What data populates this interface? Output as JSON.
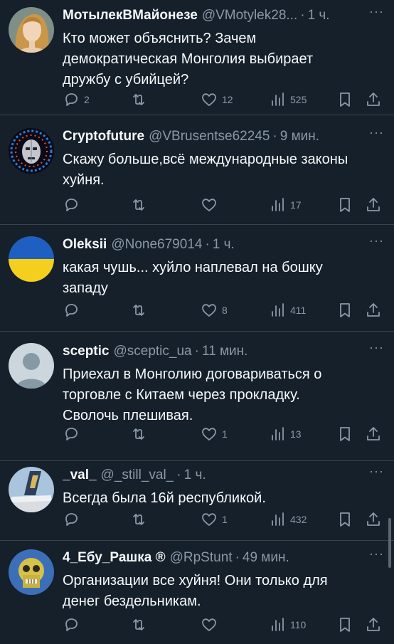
{
  "tweets": [
    {
      "name": "МотылекВМайонезе",
      "handle": "@VMotylek28...",
      "time": "1 ч.",
      "text": "Кто может объяснить? Зачем\nдемократическая Монголия выбирает\nдружбу с убийцей?",
      "replies": "2",
      "retweets": "",
      "likes": "12",
      "views": "525",
      "avatar": "venus-painting"
    },
    {
      "name": "Cryptofuture",
      "handle": "@VBrusentse62245",
      "time": "9 мин.",
      "text": "Скажу больше,всё международные законы\nхуйня.",
      "replies": "",
      "retweets": "",
      "likes": "",
      "views": "17",
      "avatar": "robot-face"
    },
    {
      "name": "Oleksii",
      "handle": "@None679014",
      "time": "1 ч.",
      "text": "какая чушь... хуйло наплевал на бошку\nзападу",
      "replies": "",
      "retweets": "",
      "likes": "8",
      "views": "411",
      "avatar": "ukraine-flag"
    },
    {
      "name": "sceptic",
      "handle": "@sceptic_ua",
      "time": "11 мин.",
      "text": "Приехал в Монголию договариваться о\nторговле с Китаем через прокладку.\nСволочь плешивая.",
      "replies": "",
      "retweets": "",
      "likes": "1",
      "views": "13",
      "avatar": "default-person"
    },
    {
      "name": "_val_",
      "handle": "@_still_val_",
      "time": "1 ч.",
      "text": "Всегда была 16й республикой.",
      "replies": "",
      "retweets": "",
      "likes": "1",
      "views": "432",
      "avatar": "airplane-tail"
    },
    {
      "name": "4_Ебу_Рашка ®",
      "handle": "@RpStunt",
      "time": "49 мин.",
      "text": "Организации все хуйня! Они только для\nденег бездельникам.",
      "replies": "",
      "retweets": "",
      "likes": "",
      "views": "110",
      "avatar": "skull-cartoon"
    }
  ],
  "colors": {
    "background": "#15202b",
    "text": "#f7f9f9",
    "muted": "#8b98a5",
    "divider": "#38444d"
  }
}
